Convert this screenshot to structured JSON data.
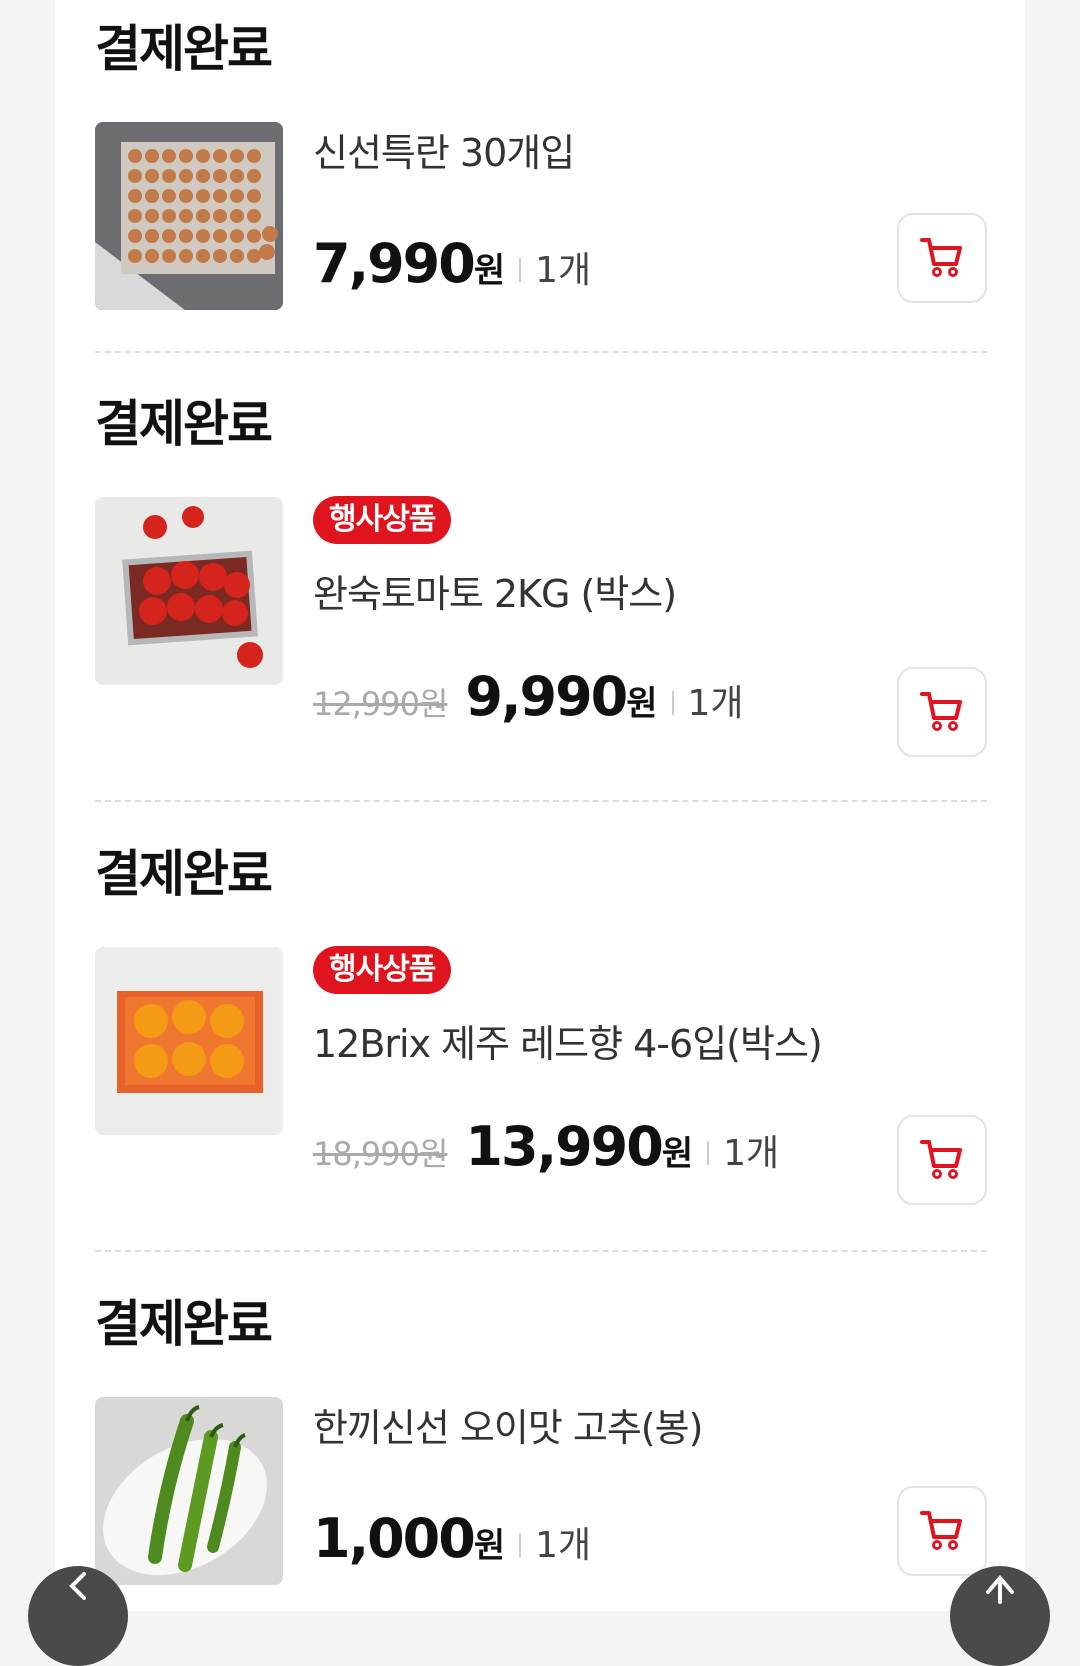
{
  "orders": [
    {
      "status": "결제완료",
      "badge": "",
      "name": "신선특란 30개입",
      "original_price": "",
      "price": "7,990",
      "currency": "원",
      "quantity": "1개",
      "image_icon": "eggs-image"
    },
    {
      "status": "결제완료",
      "badge": "행사상품",
      "name": "완숙토마토 2KG (박스)",
      "original_price": "12,990원",
      "price": "9,990",
      "currency": "원",
      "quantity": "1개",
      "image_icon": "tomatoes-image"
    },
    {
      "status": "결제완료",
      "badge": "행사상품",
      "name": "12Brix 제주 레드향 4-6입(박스)",
      "original_price": "18,990원",
      "price": "13,990",
      "currency": "원",
      "quantity": "1개",
      "image_icon": "oranges-image"
    },
    {
      "status": "결제완료",
      "badge": "",
      "name": "한끼신선 오이맛 고추(봉)",
      "original_price": "",
      "price": "1,000",
      "currency": "원",
      "quantity": "1개",
      "image_icon": "peppers-image"
    }
  ],
  "colors": {
    "accent": "#e0141e",
    "background": "#f4f4f4"
  }
}
